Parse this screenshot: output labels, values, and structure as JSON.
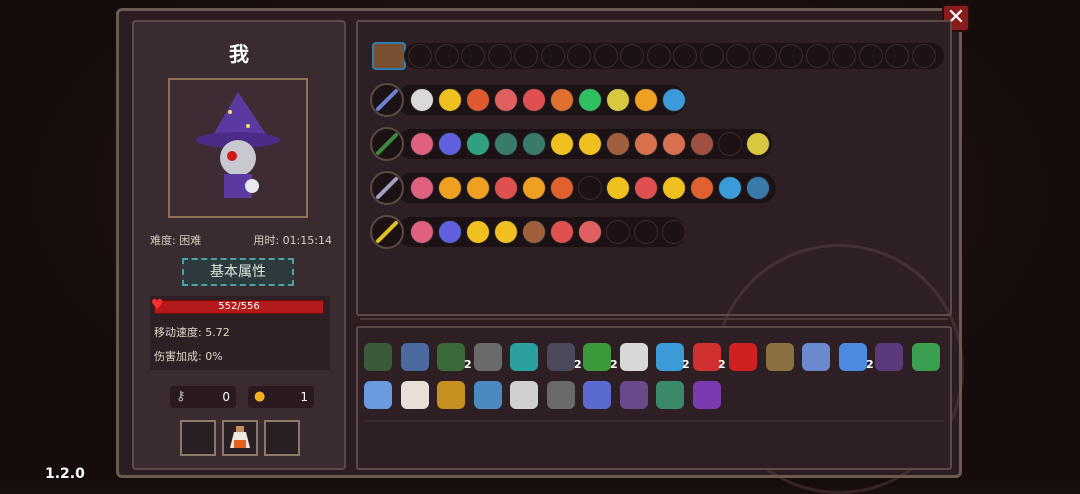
{
  "player": {
    "name": "我",
    "difficulty": "难度: 困难",
    "time": "用时: 01:15:14"
  },
  "attr_button": "基本属性",
  "stats": {
    "hp": "552/556",
    "move_speed": "移动速度: 5.72",
    "damage_bonus": "伤害加成: 0%"
  },
  "resources": {
    "keys": "0",
    "coins": "1"
  },
  "version": "1.2.0",
  "close_label": "✕",
  "weapon_rows": [
    {
      "weapon_color": "#6a7fd0",
      "skills": [
        "#d9d9d9",
        "#f0c020",
        "#e05a30",
        "#e06060",
        "#e05050",
        "#e07030",
        "#30c060",
        "#d8c840",
        "#f0a020",
        "#3a9bd8"
      ],
      "empty": 0
    },
    {
      "weapon_color": "#3a8a3a",
      "skills": [
        "#e06080",
        "#6060e0",
        "#30a080",
        "#3a7a6a",
        "#3a7a6a",
        "#f0c020",
        "#f0c020",
        "#a06040",
        "#d87050",
        "#d87050",
        "#a05040"
      ],
      "empty": 1,
      "last": "#d8c840"
    },
    {
      "weapon_color": "#a0a0c0",
      "skills": [
        "#e06080",
        "#f0a020",
        "#f0a020",
        "#e05050",
        "#f0a020",
        "#e06030"
      ],
      "empty": 1,
      "more": [
        "#f0c020",
        "#e05050",
        "#f0c020",
        "#e06030",
        "#3a9bd8",
        "#3a7aa8"
      ]
    },
    {
      "weapon_color": "#e0c020",
      "skills": [
        "#e06080",
        "#6060e0",
        "#f0c020",
        "#f0c020",
        "#a06040",
        "#e05050",
        "#e06060"
      ],
      "empty": 3
    }
  ],
  "inventory_counts": [
    "2",
    "2",
    "2",
    "2",
    "2",
    "2"
  ]
}
